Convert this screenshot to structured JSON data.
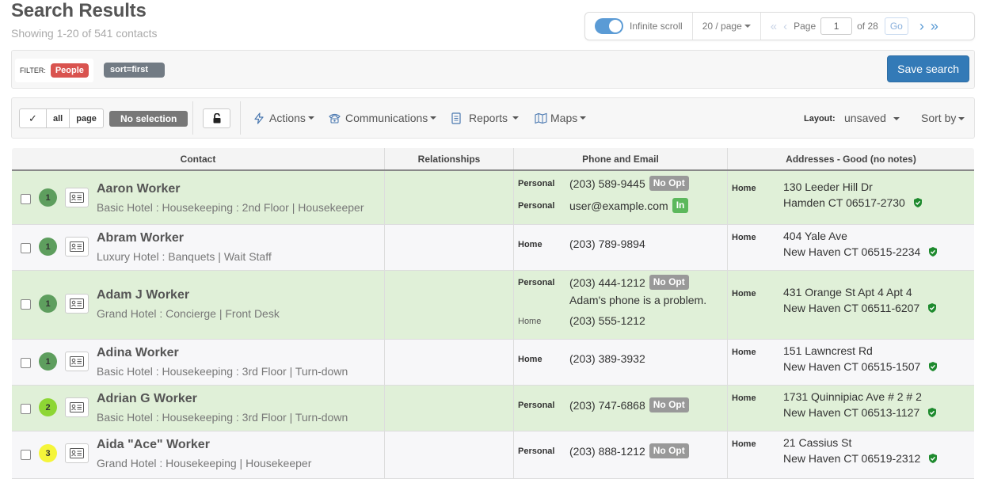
{
  "header": {
    "title": "Search Results",
    "subtitle": "Showing 1-20 of 541 contacts"
  },
  "pager": {
    "infinite_scroll_label": "Infinite scroll",
    "infinite_scroll_on": true,
    "per_page": "20 / page",
    "page_label": "Page",
    "page_value": "1",
    "of_pages": "of 28",
    "go_label": "Go"
  },
  "filter": {
    "label": "FILTER:",
    "tag": "People",
    "sort_tag": "sort=first",
    "save_label": "Save search"
  },
  "toolbar": {
    "check": "✓",
    "all": "all",
    "page": "page",
    "no_selection": "No selection",
    "actions": "Actions",
    "communications": "Communications",
    "reports": "Reports",
    "maps": "Maps",
    "layout_label": "Layout:",
    "layout_value": "unsaved",
    "sort_by": "Sort by"
  },
  "table": {
    "columns": [
      "Contact",
      "Relationships",
      "Phone and Email",
      "Addresses - Good (no notes)"
    ],
    "rows": [
      {
        "badge": "1",
        "badge_color": "#5e9e5e",
        "name": "Aaron Worker",
        "sub": "Basic Hotel : Housekeeping : 2nd Floor | Housekeeper",
        "phones": [
          {
            "type": "Personal",
            "value": "(203) 589-9445",
            "pill": "No Opt"
          },
          {
            "type": "Personal",
            "value": "user@example.com",
            "pill": "In"
          }
        ],
        "address": {
          "type": "Home",
          "line1": "130 Leeder Hill Dr",
          "line2": "Hamden CT 06517-2730"
        }
      },
      {
        "badge": "1",
        "badge_color": "#5e9e5e",
        "name": "Abram Worker",
        "sub": "Luxury Hotel : Banquets | Wait Staff",
        "phones": [
          {
            "type": "Home",
            "value": "(203) 789-9894",
            "pill": ""
          }
        ],
        "address": {
          "type": "Home",
          "line1": "404 Yale Ave",
          "line2": "New Haven CT 06515-2234"
        }
      },
      {
        "badge": "1",
        "badge_color": "#5e9e5e",
        "name": "Adam J Worker",
        "sub": "Grand Hotel : Concierge | Front Desk",
        "phones": [
          {
            "type": "Personal",
            "value": "(203) 444-1212",
            "pill": "No Opt",
            "note": "Adam's phone is a problem."
          },
          {
            "type": "Home",
            "value": "(203) 555-1212",
            "pill": ""
          }
        ],
        "address": {
          "type": "Home",
          "line1": "431 Orange St Apt 4 Apt 4",
          "line2": "New Haven CT 06511-6207"
        }
      },
      {
        "badge": "1",
        "badge_color": "#5e9e5e",
        "name": "Adina Worker",
        "sub": "Basic Hotel : Housekeeping : 3rd Floor | Turn-down",
        "phones": [
          {
            "type": "Home",
            "value": "(203) 389-3932",
            "pill": ""
          }
        ],
        "address": {
          "type": "Home",
          "line1": "151 Lawncrest Rd",
          "line2": "New Haven CT 06515-1507"
        }
      },
      {
        "badge": "2",
        "badge_color": "#8dd634",
        "name": "Adrian G Worker",
        "sub": "Basic Hotel : Housekeeping : 3rd Floor | Turn-down",
        "phones": [
          {
            "type": "Personal",
            "value": "(203) 747-6868",
            "pill": "No Opt"
          }
        ],
        "address": {
          "type": "Home",
          "line1": "1731 Quinnipiac Ave # 2 # 2",
          "line2": "New Haven CT 06513-1127"
        }
      },
      {
        "badge": "3",
        "badge_color": "#f5f53a",
        "name": "Aida \"Ace\" Worker",
        "sub": "Grand Hotel : Housekeeping | Housekeeper",
        "phones": [
          {
            "type": "Personal",
            "value": "(203) 888-1212",
            "pill": "No Opt"
          }
        ],
        "address": {
          "type": "Home",
          "line1": "21 Cassius St",
          "line2": "New Haven CT 06519-2312"
        }
      }
    ]
  },
  "colors": {
    "accent": "#337ab7",
    "row_green": "#e0f0d8",
    "tag_red": "#d9534f",
    "verified": "#1e8a2e"
  },
  "icons": [
    "check-icon",
    "lock-icon",
    "bolt-icon",
    "phone-icon",
    "report-icon",
    "map-icon",
    "contact-card-icon",
    "shield-check-icon",
    "double-chevron-left-icon",
    "chevron-left-icon",
    "chevron-right-icon",
    "double-chevron-right-icon"
  ]
}
